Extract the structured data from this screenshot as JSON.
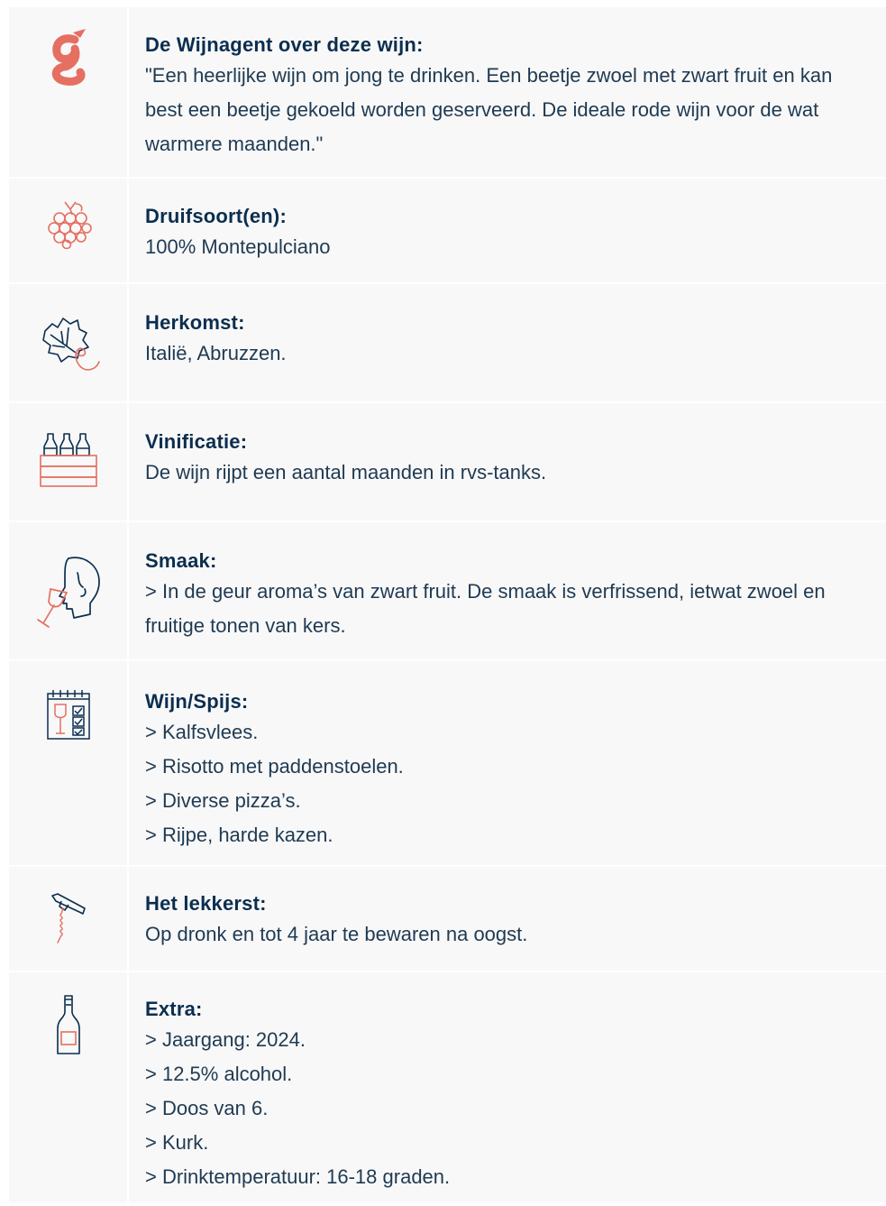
{
  "colors": {
    "navy": "#0b2e4f",
    "coral": "#e56f61",
    "panel": "#f8f8f8"
  },
  "sections": [
    {
      "icon": "wijnagent-logo-icon",
      "title": "De Wijnagent over deze wijn:",
      "text": "\"Een heerlijke wijn om jong te drinken. Een beetje zwoel met zwart fruit en kan best een beetje gekoeld worden geserveerd. De ideale rode wijn voor de wat warmere maanden.\""
    },
    {
      "icon": "grapes-icon",
      "title": "Druifsoort(en):",
      "text": "100% Montepulciano"
    },
    {
      "icon": "vine-leaf-icon",
      "title": "Herkomst:",
      "text": "Italië, Abruzzen."
    },
    {
      "icon": "wine-crate-icon",
      "title": "Vinificatie:",
      "text": "De wijn rijpt een aantal maanden in rvs-tanks."
    },
    {
      "icon": "tasting-face-icon",
      "title": "Smaak:",
      "text": "> In de geur aroma’s van zwart fruit. De smaak is verfrissend, ietwat zwoel en fruitige tonen van kers."
    },
    {
      "icon": "pairing-checklist-icon",
      "title": "Wijn/Spijs:",
      "lines": [
        "> Kalfsvlees.",
        "> Risotto met paddenstoelen.",
        "> Diverse pizza’s.",
        "> Rijpe, harde kazen."
      ]
    },
    {
      "icon": "corkscrew-icon",
      "title": "Het lekkerst:",
      "text": "Op dronk en tot 4 jaar te bewaren na oogst."
    },
    {
      "icon": "wine-bottle-icon",
      "title": "Extra:",
      "lines": [
        "> Jaargang: 2024.",
        "> 12.5% alcohol.",
        "> Doos van 6.",
        "> Kurk.",
        "> Drinktemperatuur: 16-18 graden."
      ]
    }
  ]
}
